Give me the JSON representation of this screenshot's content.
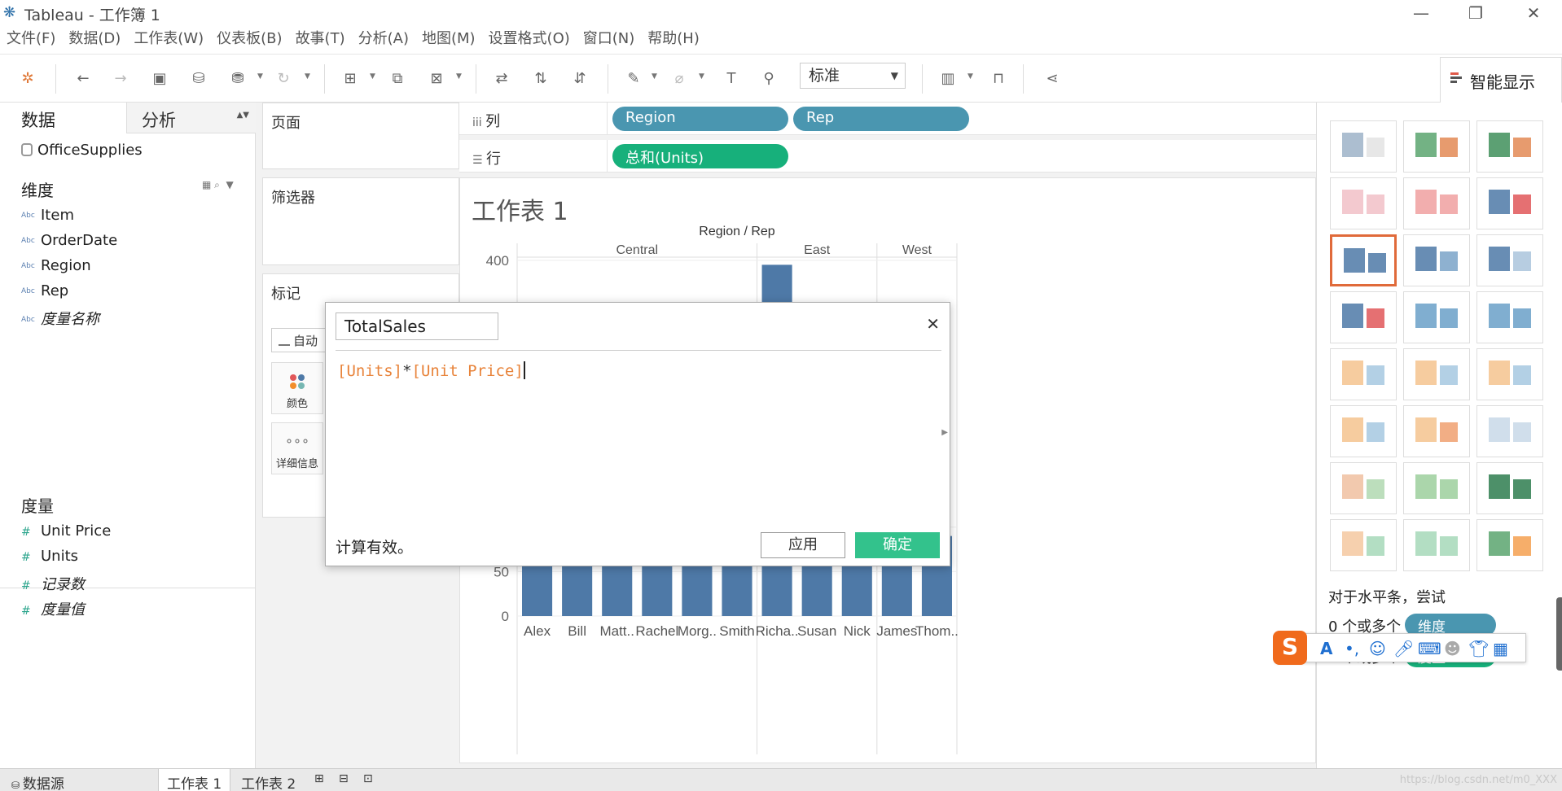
{
  "window": {
    "title": "Tableau - 工作簿 1",
    "minimize": "—",
    "restore": "❐",
    "close": "✕"
  },
  "menu": [
    "文件(F)",
    "数据(D)",
    "工作表(W)",
    "仪表板(B)",
    "故事(T)",
    "分析(A)",
    "地图(M)",
    "设置格式(O)",
    "窗口(N)",
    "帮助(H)"
  ],
  "toolbar": {
    "fit_select": "标准"
  },
  "smart_show": {
    "tab_label": "智能显示",
    "hint": "对于水平条，尝试",
    "line1_prefix": "0 个或多个",
    "pill_dimension": "维度",
    "line2_prefix": "1 个或多个",
    "pill_measure": "度量"
  },
  "data_pane": {
    "tab_data": "数据",
    "tab_analysis": "分析",
    "datasource": "OfficeSupplies",
    "dimensions_title": "维度",
    "dimensions": [
      "Item",
      "OrderDate",
      "Region",
      "Rep",
      "度量名称"
    ],
    "measures_title": "度量",
    "measures": [
      "Unit Price",
      "Units",
      "记录数",
      "度量值"
    ]
  },
  "cards": {
    "pages": "页面",
    "filters": "筛选器",
    "marks": "标记",
    "marks_type": "自动",
    "color": "颜色",
    "detail": "详细信息"
  },
  "shelves": {
    "columns_label": "列",
    "rows_label": "行",
    "columns_pills": [
      "Region",
      "Rep"
    ],
    "rows_pills": [
      "总和(Units)"
    ]
  },
  "sheet": {
    "title": "工作表 1"
  },
  "chart_data": {
    "type": "bar",
    "header": "Region / Rep",
    "regions": [
      {
        "name": "Central",
        "reps": [
          "Alex",
          "Bill",
          "Matt..",
          "Rachel",
          "Morg..",
          "Smith"
        ]
      },
      {
        "name": "East",
        "reps": [
          "Richa..",
          "Susan",
          "Nick"
        ]
      },
      {
        "name": "West",
        "reps": [
          "James",
          "Thom.."
        ]
      }
    ],
    "categories": [
      "Alex",
      "Bill",
      "Matt..",
      "Rachel",
      "Morg..",
      "Smith",
      "Richa..",
      "Susan",
      "Nick",
      "James",
      "Thom.."
    ],
    "values": [
      null,
      null,
      null,
      null,
      null,
      null,
      395,
      null,
      125,
      142,
      90
    ],
    "visible_values_note_free": true,
    "yticks": [
      0,
      50,
      100,
      400
    ],
    "ylim": [
      0,
      410
    ],
    "bar_color": "#4e79a7"
  },
  "dialog": {
    "name": "TotalSales",
    "formula_a": "[Units]",
    "formula_op": "*",
    "formula_b": "[Unit Price]",
    "status": "计算有效。",
    "apply": "应用",
    "ok": "确定"
  },
  "bottom": {
    "datasource_tab": "数据源",
    "sheet1": "工作表 1",
    "sheet2": "工作表 2",
    "watermark": "https://blog.csdn.net/m0_XXX"
  },
  "colors": {
    "accent_green": "#33c28c",
    "pill_blue": "#4a96b0",
    "pill_green": "#17b07b",
    "selected_thumb": "#e06a3a"
  }
}
